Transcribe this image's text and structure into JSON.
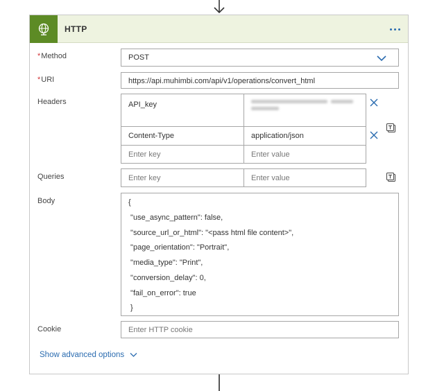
{
  "colors": {
    "accent": "#2b6cb0",
    "header_icon_bg": "#5d8b25",
    "header_bg": "#eef3e0",
    "required": "#d13438",
    "border": "#a6a6a6"
  },
  "action": {
    "title": "HTTP",
    "icon": "globe-icon",
    "more_icon": "more-ellipsis-icon"
  },
  "method": {
    "required_mark": "*",
    "label": "Method",
    "value": "POST"
  },
  "uri": {
    "required_mark": "*",
    "label": "URI",
    "value": "https://api.muhimbi.com/api/v1/operations/convert_html"
  },
  "headers": {
    "label": "Headers",
    "rows": [
      {
        "key": "API_key",
        "value": ""
      },
      {
        "key": "Content-Type",
        "value": "application/json"
      }
    ],
    "new_row": {
      "key_placeholder": "Enter key",
      "value_placeholder": "Enter value"
    }
  },
  "queries": {
    "label": "Queries",
    "key_placeholder": "Enter key",
    "value_placeholder": "Enter value"
  },
  "body": {
    "label": "Body",
    "lines": [
      "{",
      " \"use_async_pattern\": false,",
      " \"source_url_or_html\": \"<pass html file content>\",",
      " \"page_orientation\": \"Portrait\",",
      " \"media_type\": \"Print\",",
      " \"conversion_delay\": 0,",
      " \"fail_on_error\": true",
      " }"
    ]
  },
  "cookie": {
    "label": "Cookie",
    "placeholder": "Enter HTTP cookie"
  },
  "advanced": {
    "label": "Show advanced options"
  }
}
